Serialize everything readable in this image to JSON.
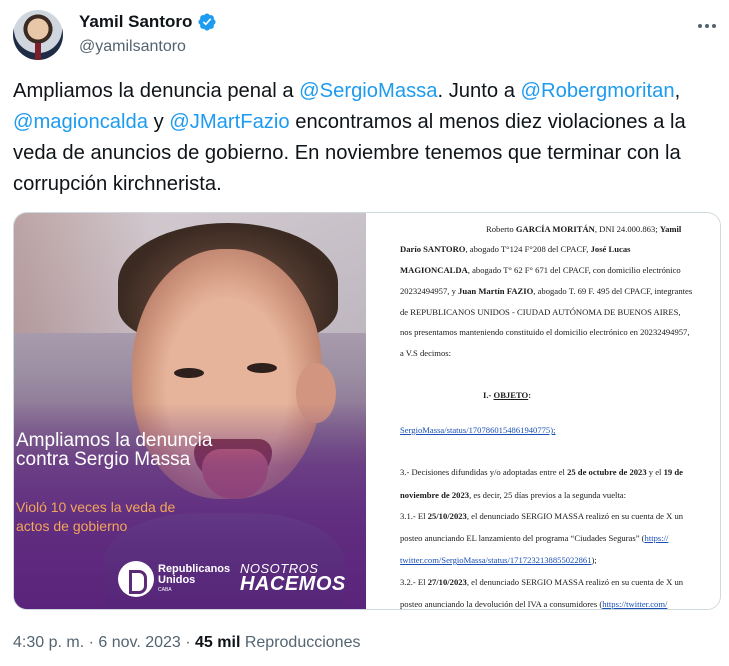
{
  "author": {
    "name": "Yamil Santoro",
    "handle": "@yamilsantoro"
  },
  "tweet": {
    "segments": [
      {
        "text": "Ampliamos la denuncia penal a ",
        "mention": false
      },
      {
        "text": "@SergioMassa",
        "mention": true
      },
      {
        "text": ". Junto a ",
        "mention": false
      },
      {
        "text": "@Robergmoritan",
        "mention": true
      },
      {
        "text": ", ",
        "mention": false
      },
      {
        "text": "@magioncalda",
        "mention": true
      },
      {
        "text": " y ",
        "mention": false
      },
      {
        "text": "@JMartFazio",
        "mention": true
      },
      {
        "text": " encontramos al menos diez violaciones a la veda de anuncios de gobierno. En noviembre tenemos que terminar con la corrupción kirchnerista.",
        "mention": false
      }
    ]
  },
  "image_left": {
    "title": "Ampliamos la denuncia contra Sergio Massa",
    "subtitle": "Violó 10 veces la veda de actos de gobierno",
    "logo1_line1": "Republicanos",
    "logo1_line2": "Unidos",
    "logo1_small": "CABA",
    "logo2_line1": "NOSOTROS",
    "logo2_line2": "HACEMOS"
  },
  "document": {
    "l1a": "Roberto ",
    "l1b": "GARCÍA MORITÁN",
    "l1c": ", DNI 24.000.863; ",
    "l1d": "Yamil",
    "l2a": "Darío SANTORO",
    "l2b": ", abogado T°124 F°208 del CPACF, ",
    "l2c": "José Lucas",
    "l3a": "MAGIONCALDA",
    "l3b": ", abogado T° 62 F° 671 del CPACF, con domicilio electrónico",
    "l4a": "20232494957, y ",
    "l4b": "Juan Martín FAZIO",
    "l4c": ", abogado T. 69 F. 495 del CPACF, integrantes",
    "l5": "de REPUBLICANOS UNIDOS - CIUDAD AUTÓNOMA DE BUENOS AIRES,",
    "l6": "nos presentamos manteniendo constituido el domicilio electrónico en 20232494957,",
    "l7": "a V.S decimos:",
    "heading_num": "I.- ",
    "heading": "OBJETO",
    "heading_colon": ":",
    "link1": "SergioMassa/status/1707860154861940775);",
    "p3a": "3.- Decisiones difundidas y/o adoptadas entre el ",
    "p3b": "25 de octubre de 2023",
    "p3c": " y el ",
    "p3d": "19 de",
    "p3e": "noviembre de 2023",
    "p3f": ", es decir, 25 días previos a la segunda vuelta:",
    "p31a": "3.1.- El ",
    "p31b": "25/10/2023",
    "p31c": ", el denunciado SERGIO MASSA realizó en su cuenta de X un",
    "p31d": "posteo anunciando EL lanzamiento del programa “Ciudades Seguras” (",
    "p31e": "https://",
    "p31f": "twitter.com/SergioMassa/status/1717232138855022861",
    "p31g": ");",
    "p32a": "3.2.- El ",
    "p32b": "27/10/2023",
    "p32c": ", el denunciado SERGIO MASSA realizó en su cuenta de X un",
    "p32d": "posteo anunciando la devolución del IVA a consumidores (",
    "p32e": "https://twitter.com/"
  },
  "meta": {
    "time": "4:30 p. m. · 6 nov. 2023 · ",
    "views": "45 mil",
    "views_label": " Reproducciones"
  },
  "colors": {
    "mention": "#1d9bf0",
    "verified": "#1d9bf0",
    "secondary_text": "#536471",
    "image_purple": "#5d2a78",
    "image_subtitle": "#f2a65a"
  }
}
